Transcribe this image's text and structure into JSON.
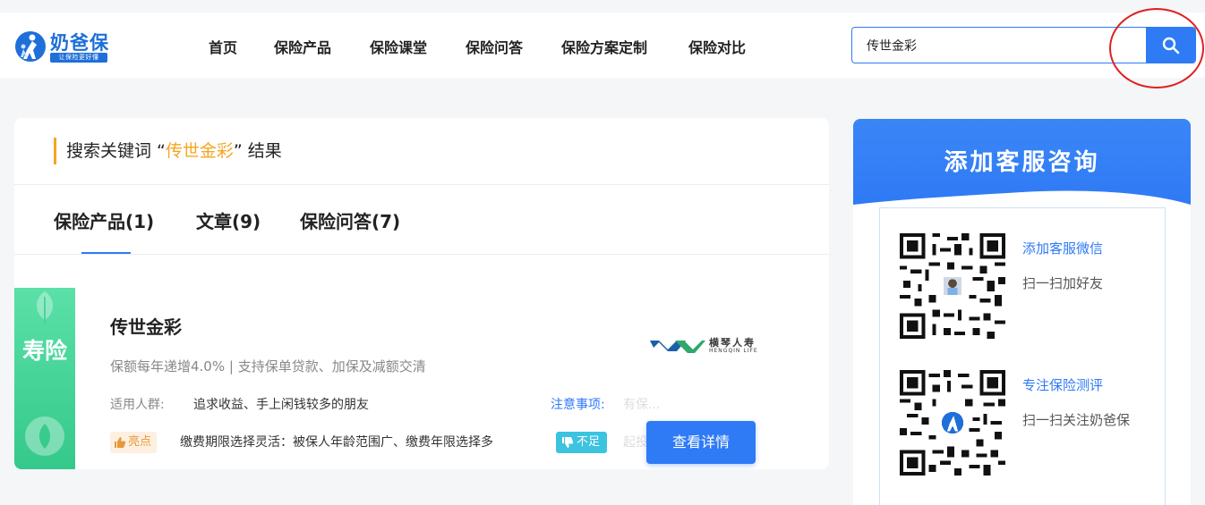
{
  "header": {
    "logo_text": "奶爸保",
    "logo_tag": "让保险更好懂",
    "nav": [
      "首页",
      "保险产品",
      "保险课堂",
      "保险问答",
      "保险方案定制",
      "保险对比"
    ],
    "search_value": "传世金彩"
  },
  "results": {
    "prefix": "搜索关键词 “",
    "keyword": "传世金彩",
    "suffix": "” 结果",
    "tabs": [
      "保险产品(1)",
      "文章(9)",
      "保险问答(7)"
    ]
  },
  "product": {
    "category": "寿险",
    "name": "传世金彩",
    "desc": "保额每年递增4.0% | 支持保单贷款、加保及减额交清",
    "crowd_label": "适用人群:",
    "crowd_value": "追求收益、手上闲钱较多的朋友",
    "notice_label": "注意事项:",
    "notice_fade": "有保...",
    "good_badge": "亮点",
    "good_text": "缴费期限选择灵活：被保人年龄范围广、缴费年限选择多",
    "bad_badge": "不足",
    "bad_fade": "起投",
    "company_name": "横琴人寿",
    "company_en": "HENGQIN LIFE",
    "detail_button": "查看详情"
  },
  "side": {
    "title": "添加客服咨询",
    "qr1_title": "添加客服微信",
    "qr1_sub": "扫一扫加好友",
    "qr2_title": "专注保险测评",
    "qr2_sub": "扫一扫关注奶爸保"
  },
  "colors": {
    "accent": "#2f7af5",
    "keyword": "#f5a623",
    "category_green": "#34c98a",
    "annotation": "#e02020"
  }
}
